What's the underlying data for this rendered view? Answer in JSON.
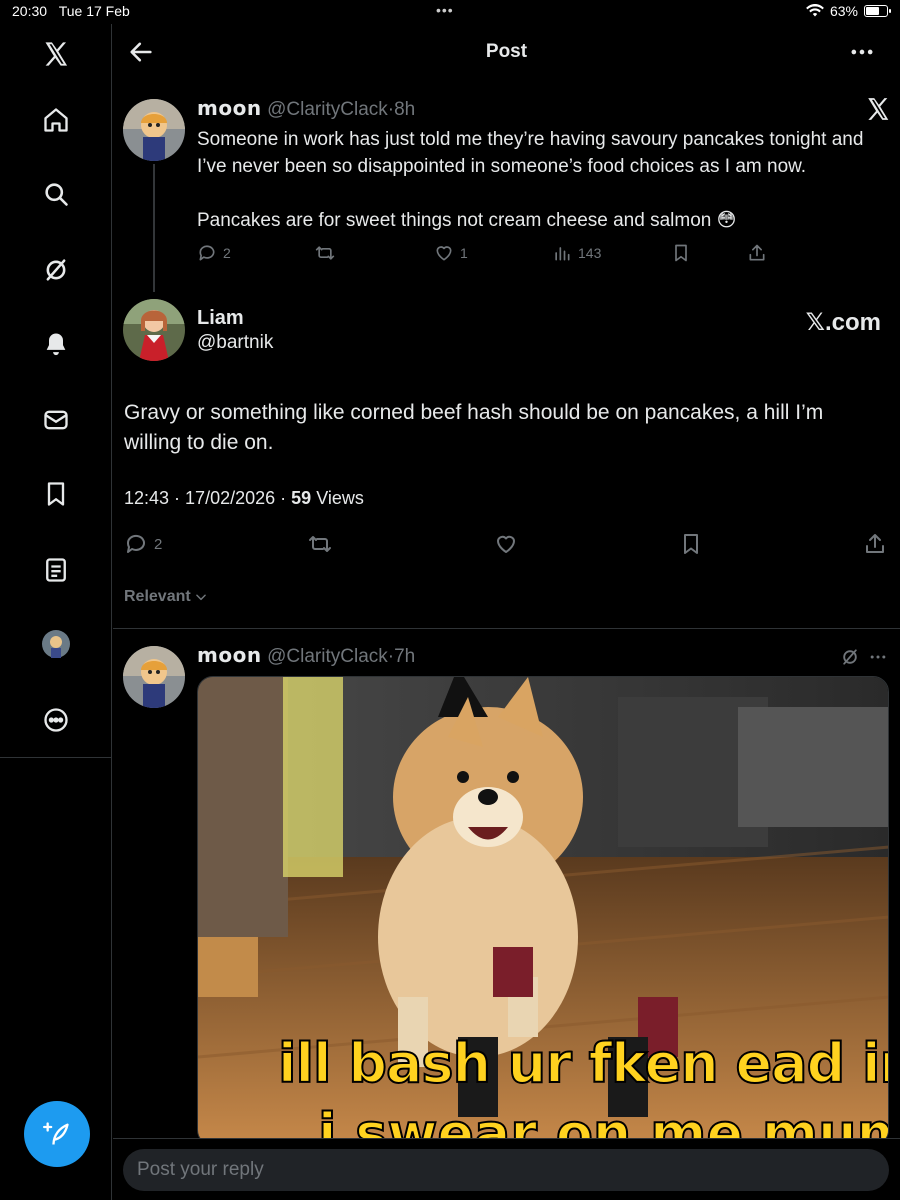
{
  "status": {
    "time": "20:30",
    "date": "Tue 17 Feb",
    "dots": "•••",
    "battery": "63%",
    "battery_level": 0.63
  },
  "sidebar": {
    "items": [
      "x-logo-icon",
      "home-icon",
      "search-icon",
      "grok-icon",
      "notifications-icon",
      "messages-icon",
      "bookmarks-icon",
      "lists-icon",
      "profile-avatar",
      "more-icon"
    ],
    "compose": "compose-post-icon"
  },
  "header": {
    "title": "Post"
  },
  "parent_tweet": {
    "name": "moon",
    "handle": "@ClarityClack",
    "sep": "·",
    "time": "8h",
    "text1": "Someone in work has just told me they’re having savoury pancakes tonight and I’ve never been so disappointed in someone’s food choices as I am now.",
    "text2": "Pancakes are for sweet things not cream cheese and salmon 😳",
    "replies": "2",
    "likes": "1",
    "views": "143"
  },
  "main_tweet": {
    "name": "Liam",
    "handle": "@bartnik",
    "badge": "𝕏.com",
    "text": "Gravy or something like corned beef hash should be on pancakes, a hill I’m willing to die on.",
    "time": "12:43",
    "date": "17/02/2026",
    "views_count": "59",
    "views_label": "Views",
    "replies": "2"
  },
  "sort": {
    "label": "Relevant"
  },
  "reply_tweet": {
    "name": "moon",
    "handle": "@ClarityClack",
    "sep": "·",
    "time": "7h",
    "caption": "ill bash ur fken ead in",
    "caption2": "i swear on me mum"
  },
  "reply_box": {
    "placeholder": "Post your reply"
  },
  "colors": {
    "accent": "#1d9bf0",
    "muted": "#71767b",
    "divider": "#2f3336"
  }
}
